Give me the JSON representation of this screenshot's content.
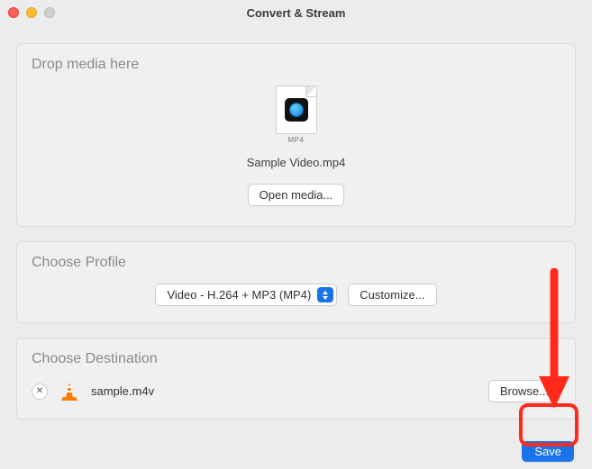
{
  "window": {
    "title": "Convert & Stream"
  },
  "drop": {
    "heading": "Drop media here",
    "file_ext": "MP4",
    "file_name": "Sample Video.mp4",
    "open_label": "Open media..."
  },
  "profile": {
    "heading": "Choose Profile",
    "selected": "Video - H.264 + MP3 (MP4)",
    "customize_label": "Customize..."
  },
  "destination": {
    "heading": "Choose Destination",
    "file_name": "sample.m4v",
    "browse_label": "Browse...",
    "remove_glyph": "✕"
  },
  "footer": {
    "save_label": "Save"
  }
}
